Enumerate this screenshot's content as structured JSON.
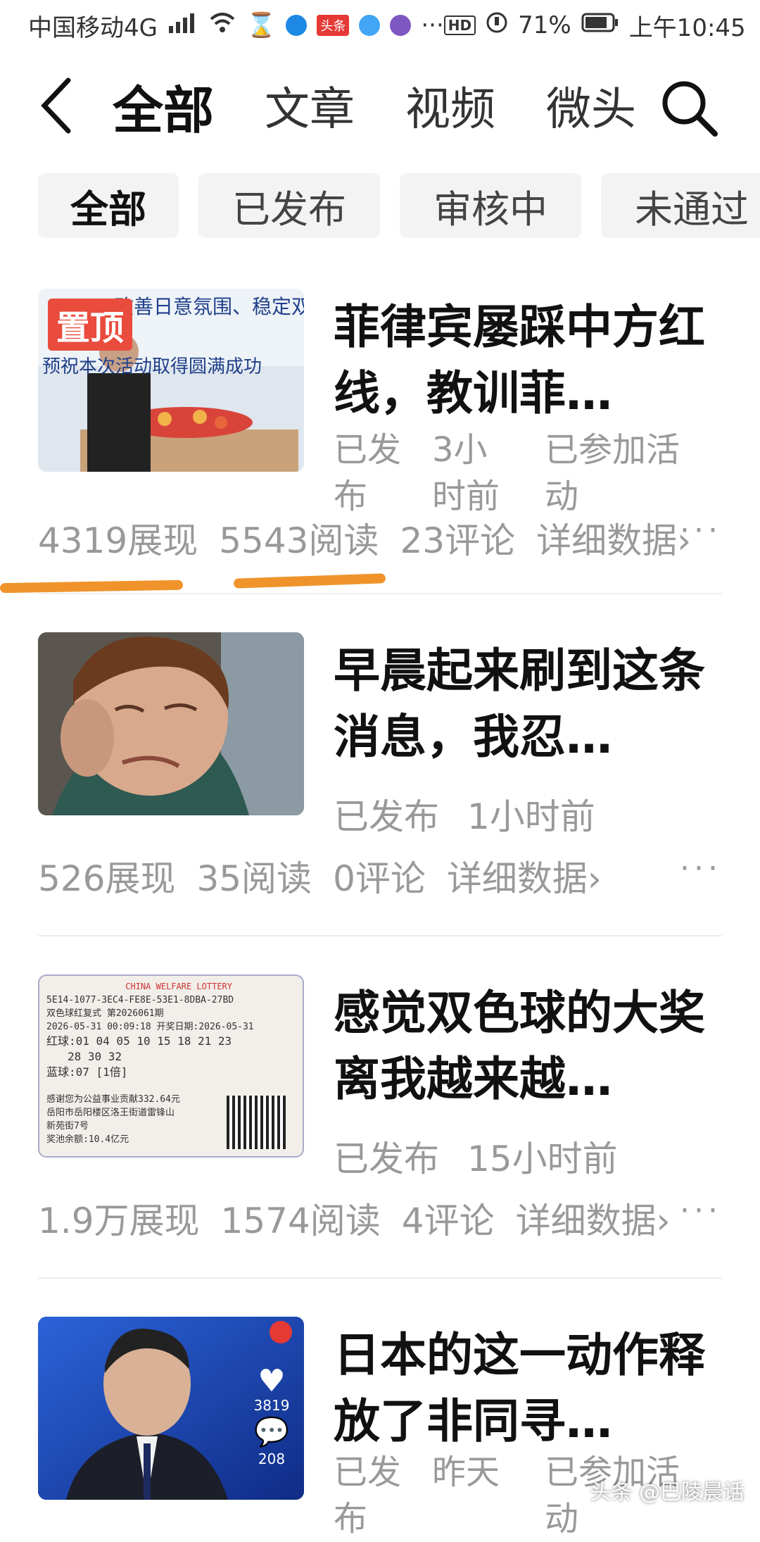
{
  "status_bar": {
    "carrier": "中国移动4G",
    "net_tag": "4G",
    "app_badge": "头条",
    "hd": "HD",
    "battery": "71%",
    "time": "上午10:45"
  },
  "nav": {
    "tabs": [
      "全部",
      "文章",
      "视频",
      "微头"
    ],
    "active_index": 0
  },
  "filters": {
    "chips": [
      "全部",
      "已发布",
      "审核中",
      "未通过"
    ],
    "active_index": 0
  },
  "articles": [
    {
      "pin": "置顶",
      "title": "菲律宾屡踩中方红线，教训菲…",
      "status": "已发布",
      "time": "3小时前",
      "extra": "已参加活动",
      "impressions": "4319展现",
      "reads": "5543阅读",
      "comments": "23评论",
      "detail": "详细数据",
      "thumb_text_1": "改善日意氛围、稳定双边",
      "thumb_text_2": "预祝本次活动取得圆满成功"
    },
    {
      "title": "早晨起来刷到这条消息，我忍…",
      "status": "已发布",
      "time": "1小时前",
      "impressions": "526展现",
      "reads": "35阅读",
      "comments": "0评论",
      "detail": "详细数据"
    },
    {
      "title": "感觉双色球的大奖离我越来越…",
      "status": "已发布",
      "time": "15小时前",
      "impressions": "1.9万展现",
      "reads": "1574阅读",
      "comments": "4评论",
      "detail": "详细数据",
      "ticket_lines": [
        "CHINA WELFARE LOTTERY",
        "5E14-1077-3EC4-FE8E-53E1-8DBA-27BD",
        "双色球红复式 第2026061期",
        "2026-05-31 00:09:18 开奖日期:2026-05-31",
        "红球:01 04 05 10 15 18 21 23",
        "28 30 32",
        "蓝球:07 [1倍]",
        "感谢您为公益事业贡献332.64元",
        "岳阳市岳阳楼区洛王街道雷锋山",
        "新苑街7号",
        "奖池余额:10.4亿元"
      ]
    },
    {
      "title": "日本的这一动作释放了非同寻…",
      "status": "已发布",
      "time": "昨天",
      "extra": "已参加活动",
      "likes": "3819",
      "comments_count": "208"
    }
  ],
  "watermark": "头条 @巴陵晨话",
  "colors": {
    "accent_underline": "#f0932b",
    "pin_red": "#e94c3d",
    "meta_gray": "#999999"
  }
}
